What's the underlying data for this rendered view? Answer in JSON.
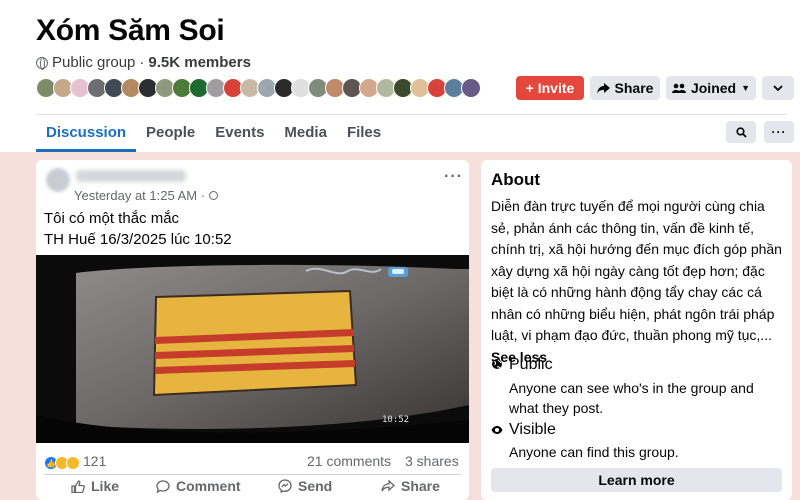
{
  "group": {
    "name": "Xóm Săm Soi",
    "privacy": "Public group",
    "separator": "·",
    "members": "9.5K members"
  },
  "header_buttons": {
    "invite": "+ Invite",
    "share": "Share",
    "joined": "Joined",
    "more_icon": "chevron-down-icon"
  },
  "tabs": [
    {
      "label": "Discussion",
      "active": true
    },
    {
      "label": "People",
      "active": false
    },
    {
      "label": "Events",
      "active": false
    },
    {
      "label": "Media",
      "active": false
    },
    {
      "label": "Files",
      "active": false
    }
  ],
  "post": {
    "timestamp": "Yesterday at 1:25 AM ·",
    "text_line1": "Tôi có một thắc mắc",
    "text_line2": "TH Huế 16/3/2025 lúc 10:52",
    "video_time": "10:52",
    "reactions": {
      "count": "121",
      "icons": [
        "like-icon",
        "haha-icon",
        "wow-icon"
      ]
    },
    "comments": "21 comments",
    "shares": "3 shares",
    "actions": [
      "Like",
      "Comment",
      "Send",
      "Share"
    ]
  },
  "about": {
    "title": "About",
    "description": "Diễn đàn trực tuyến để mọi người cùng chia sẻ, phản ánh các thông tin, vấn đề kinh tế, chính trị, xã hội hướng đến mục đích góp phần xây dựng xã hội ngày càng tốt đẹp hơn; đặc biệt là có những hành động tẩy chay các cá nhân có những biểu hiện, phát ngôn trái pháp luật, vi phạm đạo đức, thuần phong mỹ tục,...",
    "see_less": "See less",
    "public": {
      "title": "Public",
      "subtitle": "Anyone can see who's in the group and what they post."
    },
    "visible": {
      "title": "Visible",
      "subtitle": "Anyone can find this group."
    },
    "learn_more": "Learn more"
  },
  "colors": {
    "accent": "#1b6ec2",
    "invite": "#e4473b",
    "page_bg": "#f7dfdb"
  }
}
